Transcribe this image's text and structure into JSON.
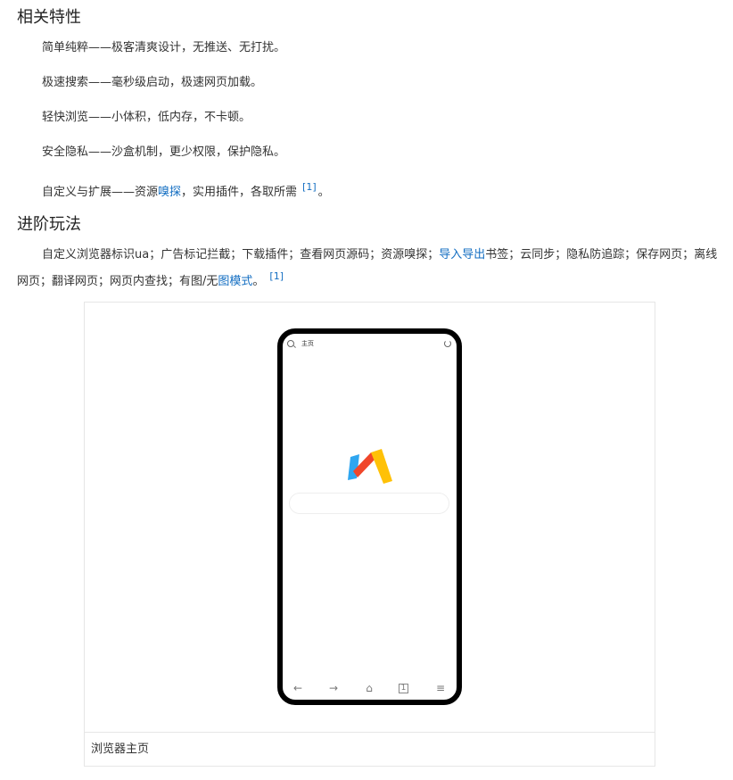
{
  "section1": {
    "title": "相关特性",
    "items": [
      "简单纯粹——极客清爽设计，无推送、无打扰。",
      "极速搜索——毫秒级启动，极速网页加载。",
      "轻快浏览——小体积，低内存，不卡顿。",
      "安全隐私——沙盒机制，更少权限，保护隐私。"
    ],
    "item5": {
      "prefix": "自定义与扩展——资源",
      "link": "嗅探",
      "suffix": "，实用插件，各取所需",
      "ref": "[1]",
      "end": "。"
    }
  },
  "section2": {
    "title": "进阶玩法",
    "para": {
      "part1": "自定义浏览器标识ua；广告标记拦截；下载插件；查看网页源码；资源嗅探；",
      "link1": "导入导出",
      "part2": "书签；云同步；隐私防追踪；保存网页；离线网页；翻译网页；网页内查找；有图/无",
      "link2": "图模式",
      "part3": "。",
      "ref": "[1]"
    }
  },
  "figure": {
    "phone_title": "主页",
    "caption": "浏览器主页",
    "icons": [
      "search-icon",
      "refresh-icon",
      "back-icon",
      "forward-icon",
      "home-icon",
      "tabs-icon",
      "menu-icon"
    ],
    "nav_glyphs": {
      "back": "←",
      "forward": "→",
      "home": "⌂",
      "tabs": "1",
      "menu": "≡"
    }
  },
  "colors": {
    "link": "#136ec2",
    "text": "#333333",
    "logo_blue": "#2ea6f0",
    "logo_red": "#f0462a",
    "logo_yellow": "#ffc107"
  }
}
